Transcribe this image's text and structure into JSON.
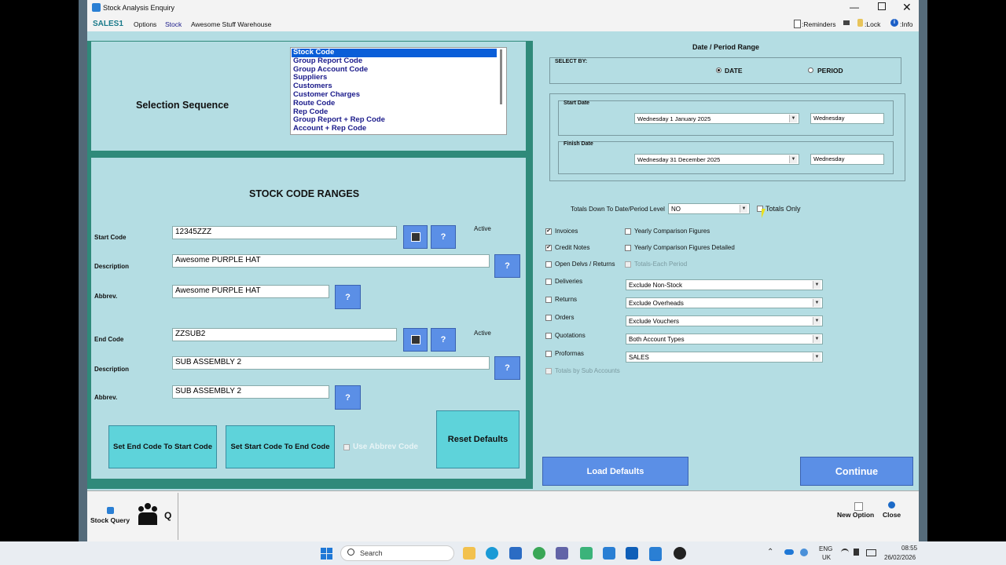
{
  "window": {
    "title": "Stock Analysis Enquiry"
  },
  "menu": {
    "app": "SALES1",
    "items": [
      "Options",
      "Stock",
      "Awesome Stuff Warehouse"
    ],
    "reminders": ":Reminders",
    "lock": ":Lock",
    "info": ":Info"
  },
  "selection": {
    "title": "Selection Sequence",
    "items": [
      "Stock Code",
      "Group Report Code",
      "Group Account Code",
      "Suppliers",
      "Customers",
      "Customer Charges",
      "Route Code",
      "Rep Code",
      "Group Report + Rep Code",
      "Account + Rep Code"
    ],
    "selected_index": 0
  },
  "ranges": {
    "title": "STOCK CODE RANGES",
    "start_code_label": "Start Code",
    "start_code": "12345ZZZ",
    "active_label": "Active",
    "description_label": "Description",
    "start_description": "Awesome PURPLE HAT",
    "abbrev_label": "Abbrev.",
    "start_abbrev": "Awesome PURPLE HAT",
    "end_code_label": "End Code",
    "end_code": "ZZSUB2",
    "end_description": "SUB ASSEMBLY 2",
    "end_abbrev": "SUB ASSEMBLY 2",
    "q": "?",
    "set_end_btn": "Set End Code To Start Code",
    "set_start_btn": "Set Start Code To End Code",
    "use_abbrev": "Use Abbrev Code",
    "reset_btn": "Reset Defaults"
  },
  "period": {
    "title": "Date / Period Range",
    "select_by": "SELECT BY:",
    "date": "DATE",
    "period": "PERIOD",
    "start_label": "Start Date",
    "start_date": "Wednesday  1  January  2025",
    "start_day": "Wednesday",
    "finish_label": "Finish Date",
    "finish_date": "Wednesday 31  December 2025",
    "finish_day": "Wednesday"
  },
  "options": {
    "totals_label": "Totals Down To Date/Period Level",
    "totals_value": "NO",
    "totals_only": "Totals Only",
    "left_checks": [
      {
        "label": "Invoices",
        "checked": true,
        "disabled": false
      },
      {
        "label": "Credit Notes",
        "checked": true,
        "disabled": false
      },
      {
        "label": "Open Delvs / Returns",
        "checked": false,
        "disabled": false
      },
      {
        "label": "Deliveries",
        "checked": false,
        "disabled": false
      },
      {
        "label": "Returns",
        "checked": false,
        "disabled": false
      },
      {
        "label": "Orders",
        "checked": false,
        "disabled": false
      },
      {
        "label": "Quotations",
        "checked": false,
        "disabled": false
      },
      {
        "label": "Proformas",
        "checked": false,
        "disabled": false
      },
      {
        "label": "Totals by Sub Accounts",
        "checked": false,
        "disabled": true
      }
    ],
    "right_checks": [
      {
        "label": "Yearly Comparison Figures",
        "disabled": false
      },
      {
        "label": "Yearly Comparison Figures Detailed",
        "disabled": false
      },
      {
        "label": "Totals-Each Period",
        "disabled": true
      }
    ],
    "selects": [
      "Exclude Non-Stock",
      "Exclude Overheads",
      "Exclude Vouchers",
      "Both Account Types",
      "SALES"
    ]
  },
  "buttons": {
    "load_defaults": "Load Defaults",
    "continue": "Continue"
  },
  "bottom": {
    "stock_query": "Stock Query",
    "q": "Q",
    "new_option": "New Option",
    "close": "Close"
  },
  "taskbar": {
    "search": "Search",
    "lang1": "ENG",
    "lang2": "UK",
    "time": "08:55",
    "date": "26/02/2026"
  }
}
